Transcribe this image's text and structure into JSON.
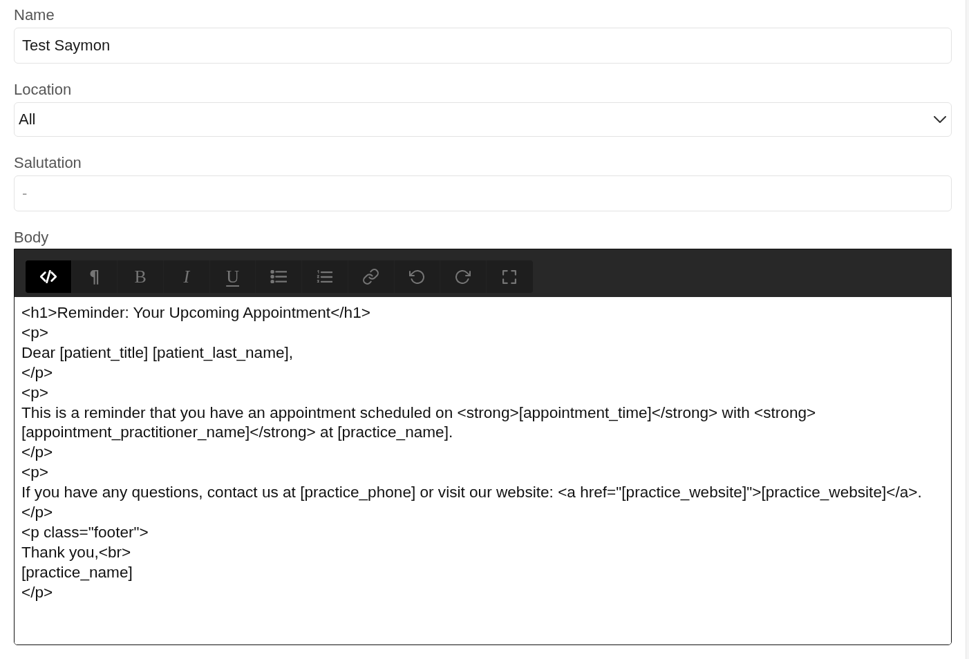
{
  "fields": [
    {
      "kind": "text",
      "label": "Name",
      "value": "Test Saymon"
    },
    {
      "kind": "select",
      "label": "Location",
      "value": "All"
    },
    {
      "kind": "text",
      "label": "Salutation",
      "placeholder": "-"
    }
  ],
  "body": {
    "label": "Body",
    "toolbar": [
      {
        "kind": "code",
        "selected": true
      },
      {
        "kind": "paragraph",
        "label": "¶",
        "selected": false
      },
      {
        "kind": "bold",
        "label": "B",
        "selected": false
      },
      {
        "kind": "italic",
        "label": "I",
        "selected": false
      },
      {
        "kind": "underline",
        "label": "U",
        "selected": false
      },
      {
        "kind": "bullet-list",
        "selected": false
      },
      {
        "kind": "numbered-list",
        "selected": false
      },
      {
        "kind": "link",
        "selected": false
      },
      {
        "kind": "undo",
        "selected": false
      },
      {
        "kind": "redo",
        "selected": false
      },
      {
        "kind": "fullscreen",
        "selected": false
      }
    ],
    "value": "<h1>Reminder: Your Upcoming Appointment</h1>\n<p>\nDear [patient_title] [patient_last_name],\n</p>\n<p>\nThis is a reminder that you have an appointment scheduled on <strong>[appointment_time]</strong> with <strong>[appointment_practitioner_name]</strong> at [practice_name].\n</p>\n<p>\nIf you have any questions, contact us at [practice_phone] or visit our website: <a href=\"[practice_website]\">[practice_website]</a>.\n</p>\n<p class=\"footer\">\nThank you,<br>\n[practice_name]\n</p>"
  }
}
